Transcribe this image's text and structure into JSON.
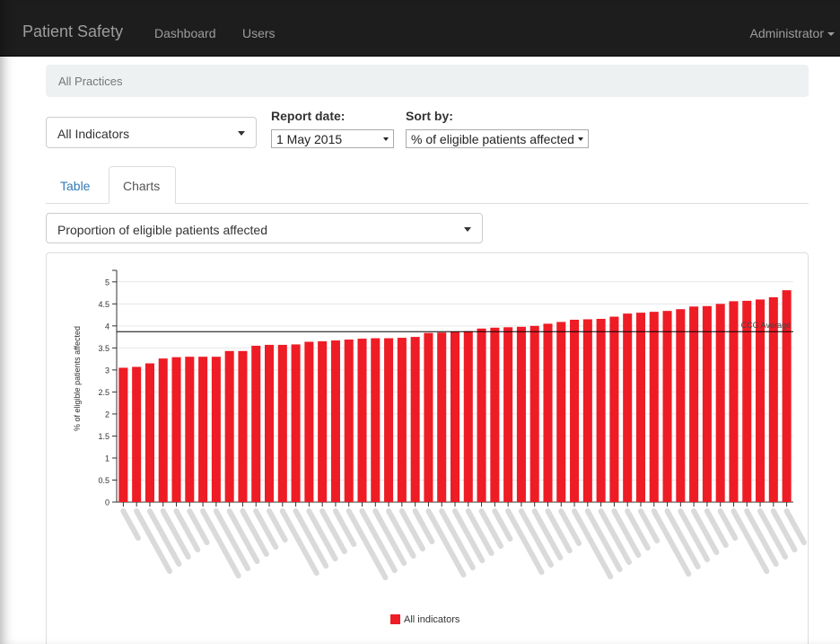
{
  "navbar": {
    "brand": "Patient Safety",
    "links": [
      "Dashboard",
      "Users"
    ],
    "user": "Administrator"
  },
  "breadcrumb": "All Practices",
  "filters": {
    "indicator": "All Indicators",
    "report_date_label": "Report date:",
    "report_date_value": "1 May 2015",
    "sort_label": "Sort by:",
    "sort_value": "% of eligible patients affected"
  },
  "tabs": [
    "Table",
    "Charts"
  ],
  "active_tab": "Charts",
  "chart_selector": "Proportion of eligible patients affected",
  "colors": {
    "bar": "#ee1c25",
    "navbar": "#1d1d1d",
    "link": "#337ab7"
  },
  "chart_data": {
    "type": "bar",
    "ylabel": "% of eligible patients affected",
    "ylim": [
      0,
      5.2
    ],
    "yticks": [
      "0",
      "0.5",
      "1",
      "1.5",
      "2",
      "2.5",
      "3",
      "3.5",
      "4",
      "4.5",
      "5"
    ],
    "categories_visible": false,
    "values": [
      3.05,
      3.07,
      3.15,
      3.26,
      3.29,
      3.3,
      3.3,
      3.3,
      3.43,
      3.43,
      3.55,
      3.57,
      3.57,
      3.58,
      3.64,
      3.65,
      3.67,
      3.69,
      3.71,
      3.72,
      3.72,
      3.73,
      3.75,
      3.84,
      3.85,
      3.87,
      3.88,
      3.94,
      3.96,
      3.97,
      3.98,
      4.0,
      4.05,
      4.09,
      4.14,
      4.15,
      4.16,
      4.21,
      4.28,
      4.3,
      4.32,
      4.34,
      4.38,
      4.44,
      4.45,
      4.5,
      4.56,
      4.57,
      4.6,
      4.65,
      4.81
    ],
    "reference_line": {
      "label": "CCG Average",
      "value": 3.87
    },
    "legend": "All indicators",
    "grid": true
  }
}
